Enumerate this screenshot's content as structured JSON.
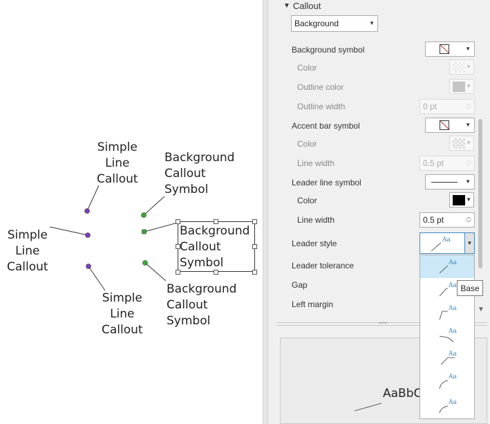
{
  "canvas": {
    "labels": {
      "simple_top": [
        "Simple",
        "Line",
        "Callout"
      ],
      "simple_left": [
        "Simple",
        "Line",
        "Callout"
      ],
      "simple_bottom": [
        "Simple",
        "Line",
        "Callout"
      ],
      "bg_top": [
        "Background",
        "Callout",
        "Symbol"
      ],
      "bg_box": [
        "Background",
        "Callout",
        "Symbol"
      ],
      "bg_bottom": [
        "Background",
        "Callout",
        "Symbol"
      ]
    },
    "colors": {
      "simple_point": "#7b3db8",
      "background_point": "#3aaa35"
    }
  },
  "panel": {
    "section_title": "Callout",
    "callout_type": "Background",
    "rows": {
      "background_symbol": "Background symbol",
      "bg_color": "Color",
      "bg_outline_color": "Outline color",
      "bg_outline_width": "Outline width",
      "bg_outline_width_value": "0 pt",
      "accent_bar_symbol": "Accent bar symbol",
      "accent_color": "Color",
      "accent_line_width": "Line width",
      "accent_line_width_value": "0.5 pt",
      "leader_line_symbol": "Leader line symbol",
      "leader_color": "Color",
      "leader_line_width": "Line width",
      "leader_line_width_value": "0.5 pt",
      "leader_style": "Leader style",
      "leader_tolerance": "Leader tolerance",
      "gap": "Gap",
      "left_margin": "Left margin"
    },
    "leader_color_value": "#000000",
    "leader_style_options": [
      "Aa",
      "Aa",
      "Aa",
      "Aa",
      "Aa",
      "Aa",
      "Aa"
    ],
    "leader_style_selected": "Aa",
    "tooltip": "Base",
    "preview_text": "AaBbC"
  }
}
